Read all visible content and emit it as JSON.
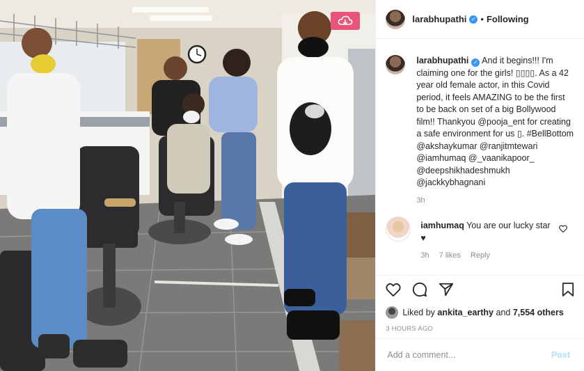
{
  "header": {
    "username": "larabhupathi",
    "verified_mark": "✓",
    "separator": "•",
    "follow_status": "Following"
  },
  "caption": {
    "username": "larabhupathi",
    "text": "And it begins!!! I'm claiming one for the girls! ▯▯▯▯. As a 42 year old female actor, in this Covid period, it feels AMAZING to be the first to be back on set of a big Bollywood film!! Thankyou @pooja_ent for creating a safe environment for us ▯. #BellBottom @akshaykumar @ranjitmtewari @iamhumaq @_vaanikapoor_ @deepshikhadeshmukh @jackkybhagnani",
    "time": "3h"
  },
  "comment": {
    "username": "iamhumaq",
    "text": "You are our lucky star ♥",
    "time": "3h",
    "likes": "7 likes",
    "reply": "Reply"
  },
  "likes_line": {
    "prefix": "Liked by",
    "user": "ankita_earthy",
    "middle": "and",
    "others": "7,554 others"
  },
  "timestamp": "3 HOURS AGO",
  "add_comment": {
    "placeholder": "Add a comment...",
    "post_label": "Post"
  },
  "colors": {
    "download_button": "#e8557a",
    "verified": "#3897f0",
    "post_button_disabled": "#b2dffc"
  },
  "icons": [
    "download-icon",
    "heart-icon",
    "comment-icon",
    "share-icon",
    "bookmark-icon",
    "small-heart-icon"
  ]
}
